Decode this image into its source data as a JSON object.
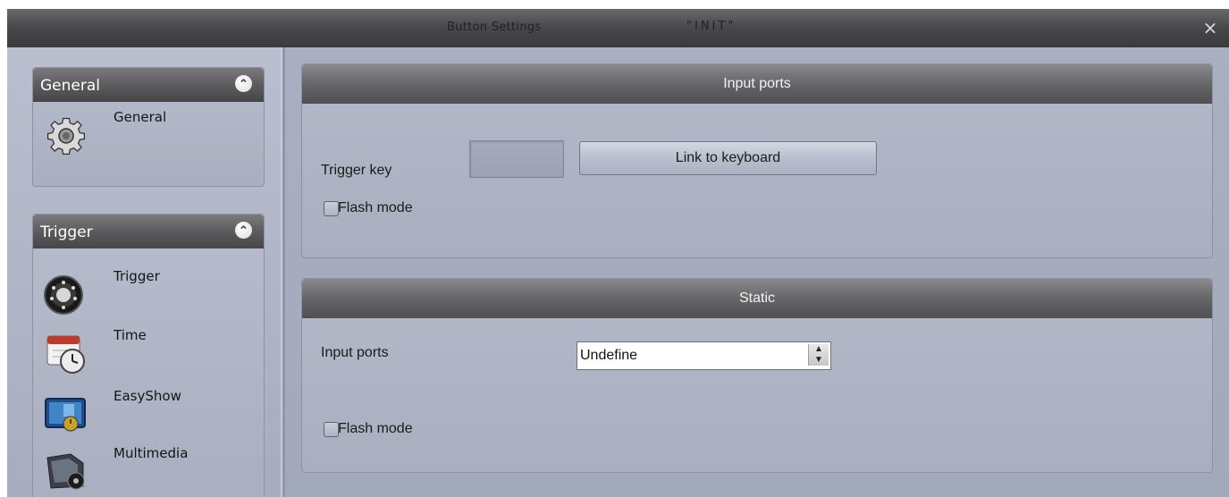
{
  "window": {
    "title": "Button  Settings",
    "document": "\"INIT\"",
    "close_glyph": "×"
  },
  "sidebar": {
    "groups": [
      {
        "title": "General",
        "collapse_glyph": "⌃",
        "items": [
          {
            "label": "General",
            "icon": "gear-icon"
          }
        ]
      },
      {
        "title": "Trigger",
        "collapse_glyph": "⌃",
        "items": [
          {
            "label": "Trigger",
            "icon": "trigger-dial-icon"
          },
          {
            "label": "Time",
            "icon": "calendar-clock-icon"
          },
          {
            "label": "EasyShow",
            "icon": "easyshow-icon"
          },
          {
            "label": "Multimedia",
            "icon": "multimedia-icon"
          }
        ]
      }
    ]
  },
  "panels": {
    "input_ports": {
      "title": "Input ports",
      "trigger_key_label": "Trigger key",
      "trigger_key_value": "",
      "link_button_label": "Link to keyboard",
      "flash_mode_label": "Flash mode",
      "flash_mode_checked": false
    },
    "static": {
      "title": "Static",
      "input_ports_label": "Input ports",
      "input_ports_value": "Undefine",
      "flash_mode_label": "Flash mode",
      "flash_mode_checked": false
    }
  }
}
